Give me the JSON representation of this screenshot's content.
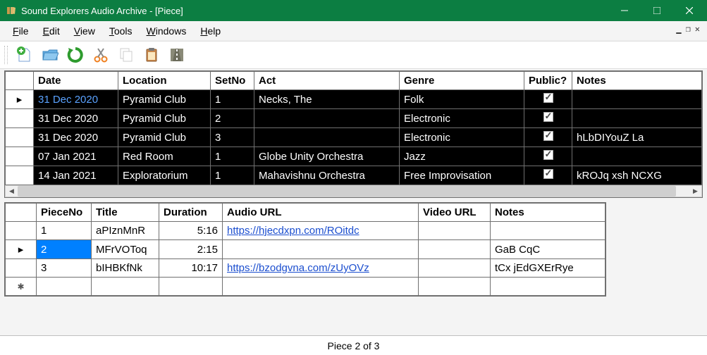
{
  "window": {
    "title": "Sound Explorers Audio Archive - [Piece]"
  },
  "menu": {
    "file": "File",
    "edit": "Edit",
    "view": "View",
    "tools": "Tools",
    "windows": "Windows",
    "help": "Help"
  },
  "main_grid": {
    "columns": [
      "Date",
      "Location",
      "SetNo",
      "Act",
      "Genre",
      "Public?",
      "Notes"
    ],
    "rows": [
      {
        "active": true,
        "date": "31 Dec 2020",
        "location": "Pyramid Club",
        "setno": "1",
        "act": "Necks, The",
        "genre": "Folk",
        "public": true,
        "notes": ""
      },
      {
        "active": false,
        "date": "31 Dec 2020",
        "location": "Pyramid Club",
        "setno": "2",
        "act": "",
        "genre": "Electronic",
        "public": true,
        "notes": ""
      },
      {
        "active": false,
        "date": "31 Dec 2020",
        "location": "Pyramid Club",
        "setno": "3",
        "act": "",
        "genre": "Electronic",
        "public": true,
        "notes": "hLbDIYouZ La"
      },
      {
        "active": false,
        "date": "07 Jan 2021",
        "location": "Red Room",
        "setno": "1",
        "act": "Globe Unity Orchestra",
        "genre": "Jazz",
        "public": true,
        "notes": ""
      },
      {
        "active": false,
        "date": "14 Jan 2021",
        "location": "Exploratorium",
        "setno": "1",
        "act": "Mahavishnu Orchestra",
        "genre": "Free Improvisation",
        "public": true,
        "notes": "kROJq xsh NCXG"
      }
    ]
  },
  "detail_grid": {
    "columns": [
      "PieceNo",
      "Title",
      "Duration",
      "Audio URL",
      "Video URL",
      "Notes"
    ],
    "rows": [
      {
        "sel": false,
        "pieceno": "1",
        "title": "aPIznMnR",
        "duration": "5:16",
        "audio": "https://hjecdxpn.com/ROitdc",
        "video": "",
        "notes": ""
      },
      {
        "sel": true,
        "pieceno": "2",
        "title": "MFrVOToq",
        "duration": "2:15",
        "audio": "",
        "video": "",
        "notes": "GaB CqC"
      },
      {
        "sel": false,
        "pieceno": "3",
        "title": "bIHBKfNk",
        "duration": "10:17",
        "audio": "https://bzodgvna.com/zUyOVz",
        "video": "",
        "notes": "tCx jEdGXErRye"
      }
    ],
    "selected_index": 1
  },
  "status": "Piece 2 of 3"
}
